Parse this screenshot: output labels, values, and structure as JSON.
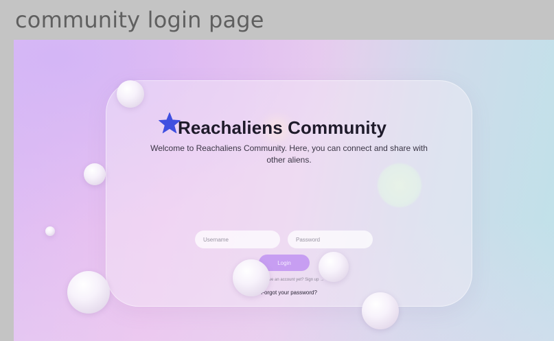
{
  "frame": {
    "title": "community login page"
  },
  "card": {
    "title": "Reachaliens Community",
    "subtitle": "Welcome to Reachaliens Community. Here, you can connect and share with other aliens."
  },
  "form": {
    "username_placeholder": "Username",
    "password_placeholder": "Password",
    "login_label": "Login",
    "signup_text": "Don't have an account yet? Sign up →",
    "forgot_label": "Forgot your password?"
  },
  "colors": {
    "accent": "#c79ef2",
    "star": "#3f4fe0",
    "title_text": "#1f1b2b",
    "background_left": "#ddbdf4",
    "background_right": "#bfe2e9"
  },
  "icons": {
    "star": "star-icon"
  }
}
